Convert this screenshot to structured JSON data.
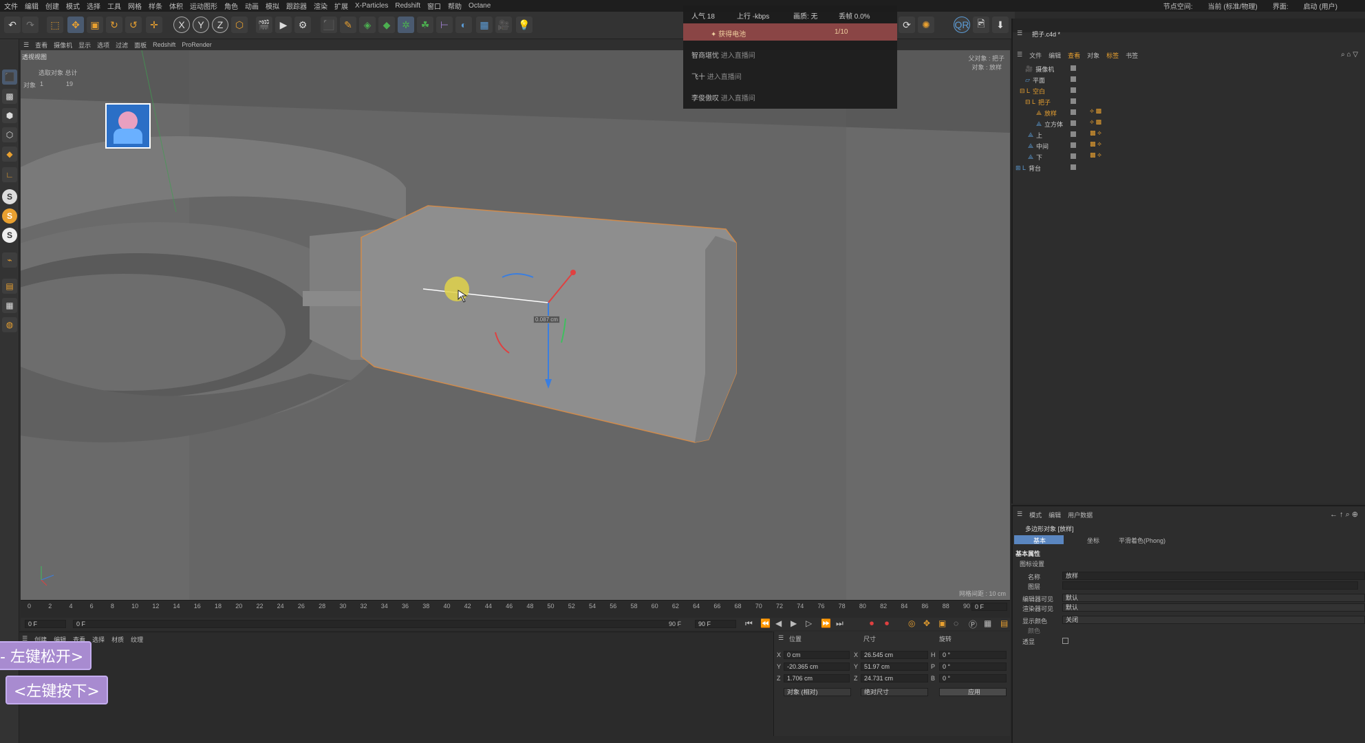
{
  "menu": [
    "文件",
    "编辑",
    "创建",
    "模式",
    "选择",
    "工具",
    "网格",
    "样条",
    "体积",
    "运动图形",
    "角色",
    "动画",
    "模拟",
    "跟踪器",
    "渲染",
    "扩展",
    "X-Particles",
    "Redshift",
    "窗口",
    "帮助",
    "Octane"
  ],
  "menu_right": [
    "节点空间:",
    "当前 (标准/物理)",
    "界面:",
    "启动 (用户)"
  ],
  "viewport_menu": [
    "查看",
    "摄像机",
    "显示",
    "选项",
    "过滤",
    "面板",
    "Redshift",
    "ProRender"
  ],
  "viewport": {
    "title": "透视视图",
    "sel_label": "选取对象 总计",
    "obj_label": "对象",
    "obj_count": "1",
    "obj_total": "19",
    "parent": "父对象 : 把子",
    "object": "对象 : 放样",
    "grid": "网格间距 : 10 cm",
    "measure": "0.087 cm"
  },
  "stream": {
    "popularity": "人气 18",
    "upload": "上行 -kbps",
    "quality": "画质: 无",
    "drop": "丢帧 0.0%",
    "battery": "✦ 获得电池",
    "battery_count": "1/10",
    "entries": [
      {
        "name": "智商堪忧",
        "act": "进入直播间"
      },
      {
        "name": "飞十",
        "act": "进入直播间"
      },
      {
        "name": "李俊傲叹",
        "act": "进入直播间"
      }
    ]
  },
  "timeline": {
    "ticks": [
      "0",
      "2",
      "4",
      "6",
      "8",
      "10",
      "12",
      "14",
      "16",
      "18",
      "20",
      "22",
      "24",
      "26",
      "28",
      "30",
      "32",
      "34",
      "36",
      "38",
      "40",
      "42",
      "44",
      "46",
      "48",
      "50",
      "52",
      "54",
      "56",
      "58",
      "60",
      "62",
      "64",
      "66",
      "68",
      "70",
      "72",
      "74",
      "76",
      "78",
      "80",
      "82",
      "84",
      "86",
      "88",
      "90"
    ],
    "current": "0 F",
    "start": "0 F",
    "end": "90 F",
    "end2": "90 F",
    "frame_field": "0 F"
  },
  "mat_tabs": [
    "创建",
    "编辑",
    "查看",
    "选择",
    "材质",
    "纹理"
  ],
  "keys": {
    "release": "- 左键松开>",
    "press": "<左键按下>"
  },
  "coords": {
    "pos_label": "位置",
    "size_label": "尺寸",
    "rot_label": "旋转",
    "px": "0 cm",
    "py": "-20.365 cm",
    "pz": "1.706 cm",
    "sx": "26.545 cm",
    "sy": "51.97 cm",
    "sz": "24.731 cm",
    "rh": "0 °",
    "rp": "0 °",
    "rb": "0 °",
    "mode1": "对象 (相对)",
    "mode2": "绝对尺寸",
    "apply": "应用"
  },
  "objmgr": {
    "file": "把子.c4d *",
    "tabs": [
      "文件",
      "编辑",
      "查看",
      "对象",
      "标签",
      "书签"
    ],
    "items": [
      "摄像机",
      "平面",
      "空白",
      "把子",
      "放样",
      "立方体",
      "上",
      "中间",
      "下",
      "背台"
    ]
  },
  "attr": {
    "tabs": [
      "模式",
      "编辑",
      "用户数据"
    ],
    "obj_title": "多边形对象 [放样]",
    "subtabs": [
      "基本",
      "坐标",
      "平滑着色(Phong)"
    ],
    "section": "基本属性",
    "icon_set": "图标设置",
    "name_label": "名称",
    "name_val": "放样",
    "layer_label": "图层",
    "editor_vis": "编辑器可见",
    "editor_val": "默认",
    "render_vis": "渲染器可见",
    "render_val": "默认",
    "display_color": "显示颜色",
    "display_val": "关闭",
    "color_label": "颜色",
    "transparent": "透显"
  }
}
